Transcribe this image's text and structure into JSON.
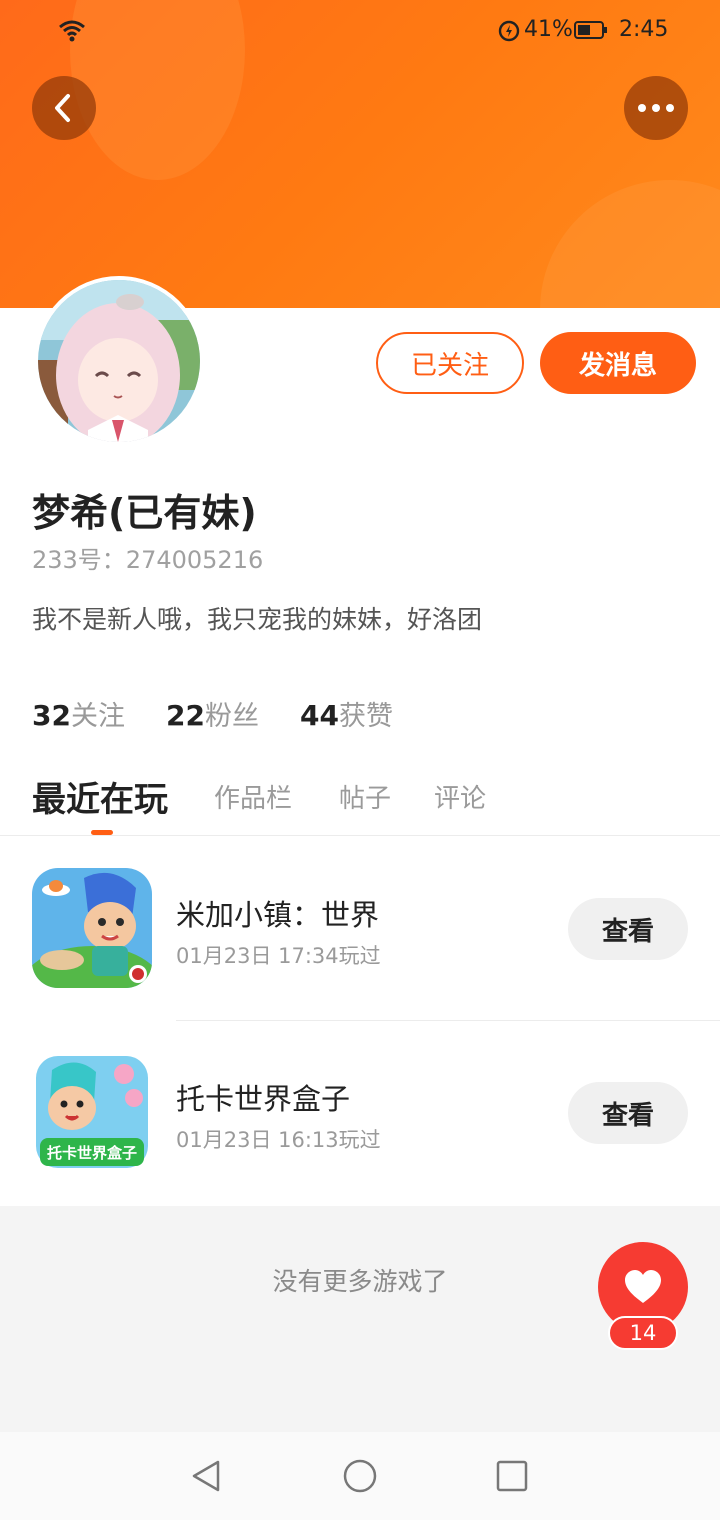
{
  "status_bar": {
    "battery_percent": "41%",
    "time": "2:45"
  },
  "header": {
    "accent_color": "#ff6a1a",
    "back_icon": "chevron-left-icon",
    "more_icon": "more-dots-icon"
  },
  "profile": {
    "name": "梦希(已有妹)",
    "uid_line": "233号：274005216",
    "bio": "我不是新人哦，我只宠我的妹妹，好洛团",
    "follow_label": "已关注",
    "message_label": "发消息"
  },
  "stats": [
    {
      "num": "32",
      "label": "关注"
    },
    {
      "num": "22",
      "label": "粉丝"
    },
    {
      "num": "44",
      "label": "获赞"
    }
  ],
  "tabs": [
    {
      "label": "最近在玩",
      "active": true
    },
    {
      "label": "作品栏"
    },
    {
      "label": "帖子"
    },
    {
      "label": "评论"
    }
  ],
  "games": [
    {
      "name": "米加小镇：世界",
      "time": "01月23日 17:34玩过",
      "action": "查看",
      "icon_text": ""
    },
    {
      "name": "托卡世界盒子",
      "time": "01月23日 16:13玩过",
      "action": "查看",
      "icon_text": "托卡世界盒子"
    }
  ],
  "footer": {
    "no_more": "没有更多游戏了"
  },
  "like": {
    "count": "14",
    "color": "#f63b32"
  }
}
